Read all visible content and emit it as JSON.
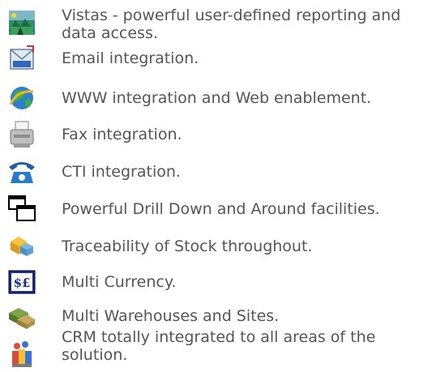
{
  "features": [
    {
      "icon": "landscape-icon",
      "text": "Vistas - powerful user-defined reporting and data access."
    },
    {
      "icon": "email-icon",
      "text": "Email integration."
    },
    {
      "icon": "globe-icon",
      "text": "WWW integration and Web enablement."
    },
    {
      "icon": "fax-icon",
      "text": "Fax integration."
    },
    {
      "icon": "telephone-icon",
      "text": "CTI integration."
    },
    {
      "icon": "windows-icon",
      "text": "Powerful Drill Down and Around facilities."
    },
    {
      "icon": "stock-cubes-icon",
      "text": "Traceability of Stock throughout."
    },
    {
      "icon": "currency-icon",
      "text": "Multi Currency."
    },
    {
      "icon": "warehouse-icon",
      "text": "Multi Warehouses and Sites."
    },
    {
      "icon": "crm-icon",
      "text": "CRM totally integrated to all areas of the solution."
    }
  ]
}
